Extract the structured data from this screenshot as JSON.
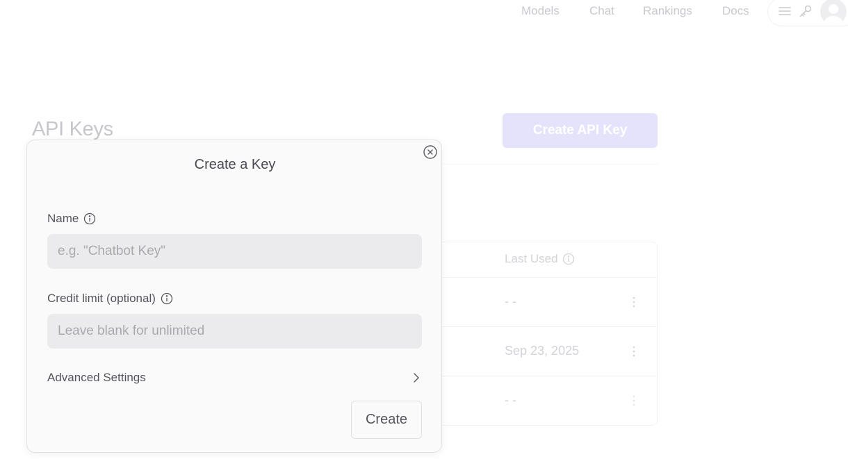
{
  "nav": {
    "links": [
      "Models",
      "Chat",
      "Rankings",
      "Docs"
    ],
    "icons": [
      "menu-icon",
      "key-icon",
      "avatar"
    ]
  },
  "page": {
    "title": "API Keys",
    "create_button": "Create API Key",
    "table": {
      "last_used_header": "Last Used",
      "rows": [
        {
          "last_used": "- -"
        },
        {
          "last_used": "Sep 23, 2025"
        },
        {
          "last_used": "- -"
        }
      ]
    }
  },
  "modal": {
    "title": "Create a Key",
    "name_label": "Name",
    "name_placeholder": "e.g. \"Chatbot Key\"",
    "name_value": "",
    "credit_label": "Credit limit (optional)",
    "credit_placeholder": "Leave blank for unlimited",
    "credit_value": "",
    "advanced_label": "Advanced Settings",
    "create_label": "Create"
  },
  "colors": {
    "accent_disabled": "#e4e3fb",
    "modal_bg": "#fafafa",
    "input_bg": "#ebebed"
  }
}
